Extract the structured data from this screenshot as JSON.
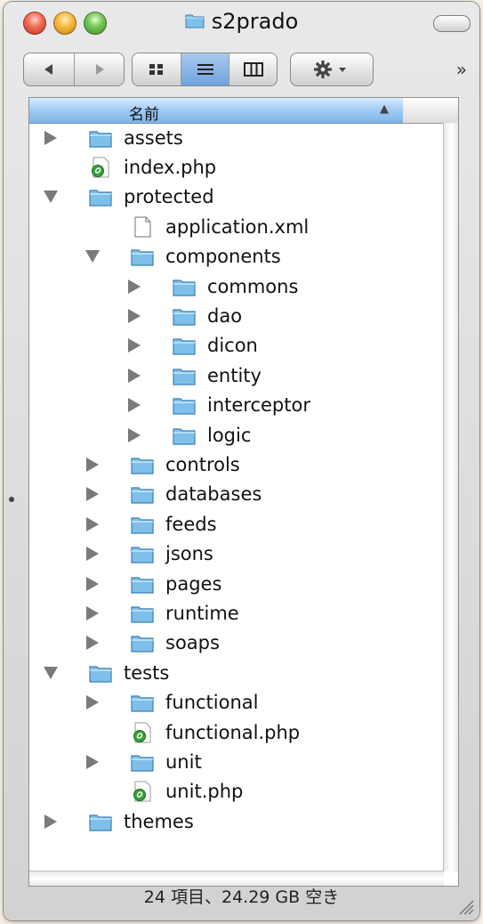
{
  "window": {
    "title": "s2prado"
  },
  "toolbar": {
    "back_icon": "back-arrow-icon",
    "forward_icon": "forward-arrow-icon",
    "view_icons": [
      "icon-view-icon",
      "list-view-icon",
      "column-view-icon"
    ],
    "active_view": "list-view-icon",
    "action_icon": "gear-icon",
    "overflow_label": "»"
  },
  "list": {
    "column_header": "名前",
    "sort": "ascending",
    "rows": [
      {
        "name": "assets",
        "type": "folder",
        "depth": 0,
        "disclosure": "collapsed"
      },
      {
        "name": "index.php",
        "type": "php",
        "depth": 0,
        "disclosure": "none"
      },
      {
        "name": "protected",
        "type": "folder",
        "depth": 0,
        "disclosure": "expanded"
      },
      {
        "name": "application.xml",
        "type": "file",
        "depth": 1,
        "disclosure": "none"
      },
      {
        "name": "components",
        "type": "folder",
        "depth": 1,
        "disclosure": "expanded"
      },
      {
        "name": "commons",
        "type": "folder",
        "depth": 2,
        "disclosure": "collapsed"
      },
      {
        "name": "dao",
        "type": "folder",
        "depth": 2,
        "disclosure": "collapsed"
      },
      {
        "name": "dicon",
        "type": "folder",
        "depth": 2,
        "disclosure": "collapsed"
      },
      {
        "name": "entity",
        "type": "folder",
        "depth": 2,
        "disclosure": "collapsed"
      },
      {
        "name": "interceptor",
        "type": "folder",
        "depth": 2,
        "disclosure": "collapsed"
      },
      {
        "name": "logic",
        "type": "folder",
        "depth": 2,
        "disclosure": "collapsed"
      },
      {
        "name": "controls",
        "type": "folder",
        "depth": 1,
        "disclosure": "collapsed"
      },
      {
        "name": "databases",
        "type": "folder",
        "depth": 1,
        "disclosure": "collapsed"
      },
      {
        "name": "feeds",
        "type": "folder",
        "depth": 1,
        "disclosure": "collapsed"
      },
      {
        "name": "jsons",
        "type": "folder",
        "depth": 1,
        "disclosure": "collapsed"
      },
      {
        "name": "pages",
        "type": "folder",
        "depth": 1,
        "disclosure": "collapsed"
      },
      {
        "name": "runtime",
        "type": "folder",
        "depth": 1,
        "disclosure": "collapsed"
      },
      {
        "name": "soaps",
        "type": "folder",
        "depth": 1,
        "disclosure": "collapsed"
      },
      {
        "name": "tests",
        "type": "folder",
        "depth": 0,
        "disclosure": "expanded"
      },
      {
        "name": "functional",
        "type": "folder",
        "depth": 1,
        "disclosure": "collapsed"
      },
      {
        "name": "functional.php",
        "type": "php",
        "depth": 1,
        "disclosure": "none"
      },
      {
        "name": "unit",
        "type": "folder",
        "depth": 1,
        "disclosure": "collapsed"
      },
      {
        "name": "unit.php",
        "type": "php",
        "depth": 1,
        "disclosure": "none"
      },
      {
        "name": "themes",
        "type": "folder",
        "depth": 0,
        "disclosure": "collapsed"
      }
    ]
  },
  "status_bar": {
    "text": "24 項目、24.29 GB 空き"
  },
  "colors": {
    "folder_fill": "#7fc0ea",
    "folder_stroke": "#3b7fb3",
    "header_blue": "#8fc0ec",
    "php_green": "#3aa13a"
  }
}
